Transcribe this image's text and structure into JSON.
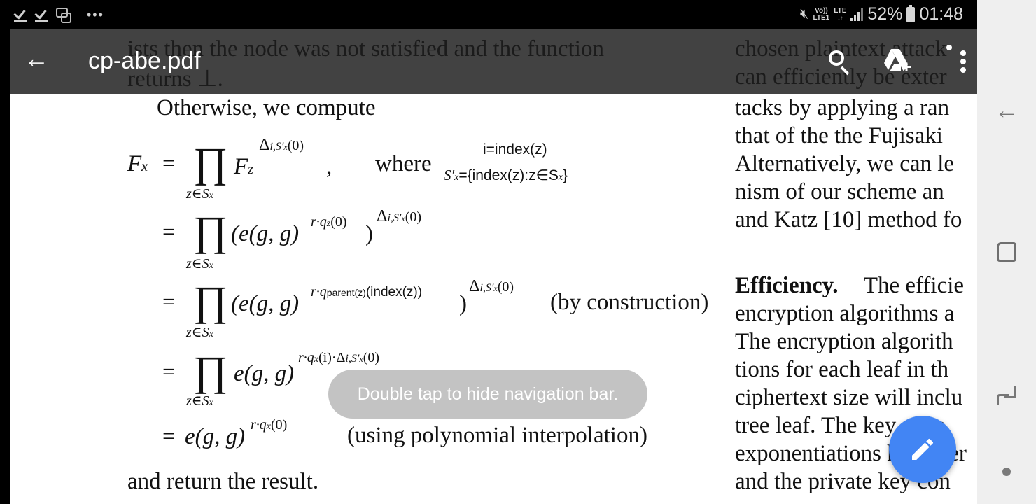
{
  "status_bar": {
    "left_icons": [
      "check-icon",
      "check-icon",
      "screen-recorder-icon",
      "more-notifications-icon"
    ],
    "more_notifications": "•••",
    "mute_icon": "mute-icon",
    "volte_top": "Vo))",
    "volte_bottom": "LTE1",
    "network_label": "LTE",
    "signal_icon": "signal-icon",
    "battery_percent": "52%",
    "time": "01:48"
  },
  "app_bar": {
    "back_icon": "←",
    "title": "cp-abe.pdf",
    "actions": [
      "search-icon",
      "add-to-drive-icon",
      "more-options-icon"
    ]
  },
  "document": {
    "left_column": {
      "partial_top_1": "ists then the node was not satisfied and the function",
      "partial_top_2": "returns ⊥.",
      "intro": "Otherwise, we compute",
      "eq1": {
        "lhs": "F",
        "lhs_sub": "x",
        "eq": "=",
        "prod": "∏",
        "prod_sub": "z∈S",
        "prod_sub_x": "x",
        "base": "F",
        "base_sub": "z",
        "exp": "Δ",
        "exp_sub": "i,S′",
        "exp_sub_x": "x",
        "exp_tail": "(0)",
        "comma": ",",
        "where": "where",
        "cond1": "i=index(z)",
        "cond2": "S′",
        "cond2_sub": "x",
        "cond2_tail": "={index(z):z∈S",
        "cond2_tail_sub": "x",
        "cond2_close": "}"
      },
      "eq2": {
        "eq": "=",
        "prod": "∏",
        "prod_sub": "z∈S",
        "prod_sub_x": "x",
        "body": "(e(g, g)",
        "exp": "r·q",
        "exp_sub": "z",
        "exp_tail": "(0)",
        "close": ")",
        "outer_exp": "Δ",
        "outer_sub": "i,S′",
        "outer_sub_x": "x",
        "outer_tail": "(0)"
      },
      "eq3": {
        "eq": "=",
        "prod": "∏",
        "prod_sub": "z∈S",
        "prod_sub_x": "x",
        "body": "(e(g, g)",
        "exp": "r·q",
        "exp_sub": "parent(z)",
        "exp_tail": "(index(z))",
        "close": ")",
        "outer_exp": "Δ",
        "outer_sub": "i,S′",
        "outer_sub_x": "x",
        "outer_tail": "(0)",
        "note": "(by construction)"
      },
      "eq4": {
        "eq": "=",
        "prod": "∏",
        "prod_sub": "z∈S",
        "prod_sub_x": "x",
        "body": "e(g, g)",
        "exp": "r·q",
        "exp_sub": "x",
        "exp_tail": "(i)·Δ",
        "exp_sub2": "i,S′",
        "exp_sub2_x": "x",
        "exp_tail2": "(0)"
      },
      "eq5": {
        "eq": "=",
        "body": "e(g, g)",
        "exp": "r·q",
        "exp_sub": "x",
        "exp_tail": "(0)",
        "note": "(using polynomial interpolation)"
      },
      "closing": "and return the result."
    },
    "right_column": {
      "lines": [
        "chosen plaintext attack",
        "can efficiently be exter",
        "tacks by applying a ran",
        "that of the the Fujisaki",
        "Alternatively, we can le",
        "nism of our scheme an",
        "and Katz [10] method fo"
      ],
      "efficiency_heading": "Efficiency.",
      "efficiency_lines": [
        "The efficie",
        "encryption algorithms a",
        "The encryption algorith",
        "tions for each leaf in th",
        "ciphertext size will inclu",
        "tree leaf.  The key gene",
        "exponentiations however",
        "and the private key con"
      ]
    }
  },
  "toast": {
    "message": "Double tap to hide navigation bar."
  },
  "fab": {
    "icon": "edit-pencil-icon",
    "color": "#4285f4"
  },
  "nav_bar": {
    "buttons": [
      "back-icon",
      "home-icon",
      "recent-apps-icon"
    ],
    "dot": "nav-hide-dot"
  }
}
